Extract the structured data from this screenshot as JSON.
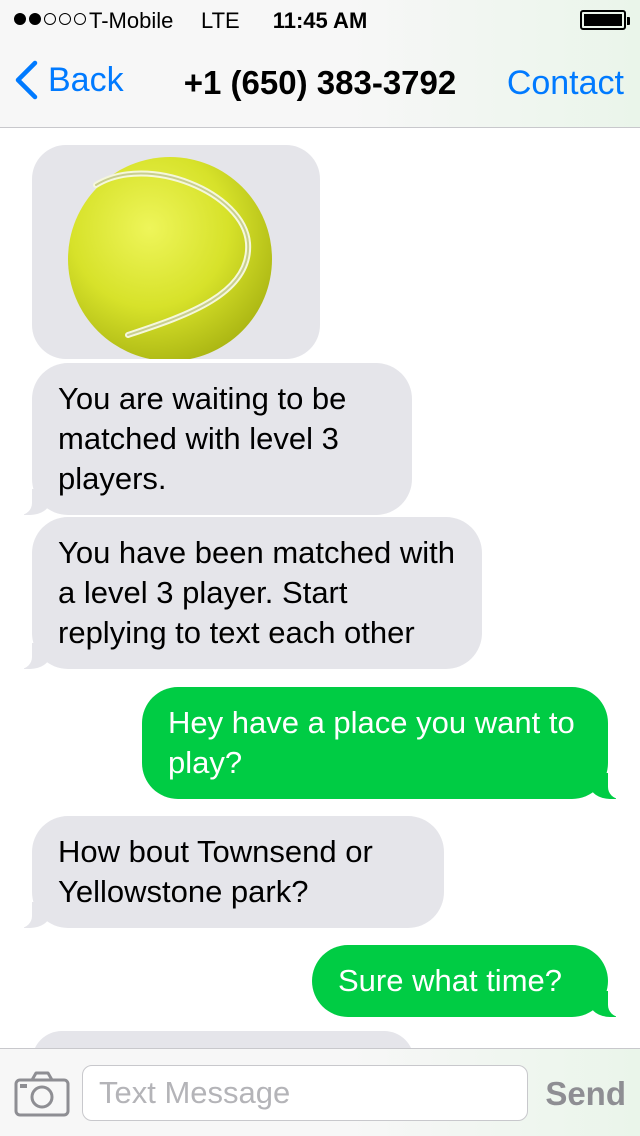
{
  "status_bar": {
    "carrier": "T-Mobile",
    "network": "LTE",
    "time": "11:45 AM",
    "signal_bars_filled": 2,
    "signal_bars_total": 5
  },
  "nav": {
    "back_label": "Back",
    "title": "+1 (650) 383-3792",
    "contact_label": "Contact"
  },
  "messages": {
    "image": {
      "icon": "tennis-ball-image"
    },
    "m1": {
      "direction": "incoming",
      "text": "You are waiting to be matched with level 3 players."
    },
    "m2": {
      "direction": "incoming",
      "text": "You have been matched with a level 3 player. Start replying to text each other"
    },
    "m3": {
      "direction": "outgoing",
      "text": "Hey have a place you want to play?"
    },
    "m4": {
      "direction": "incoming",
      "text": "How bout Townsend or Yellowstone  park?"
    },
    "m5": {
      "direction": "outgoing",
      "text": "Sure what time?"
    }
  },
  "input_bar": {
    "placeholder": "Text Message",
    "value": "",
    "send_label": "Send",
    "camera_icon": "camera-icon"
  },
  "colors": {
    "ios_blue": "#007aff",
    "incoming_bubble": "#e5e5ea",
    "outgoing_bubble": "#00cc44",
    "send_disabled": "#8e8e93"
  }
}
